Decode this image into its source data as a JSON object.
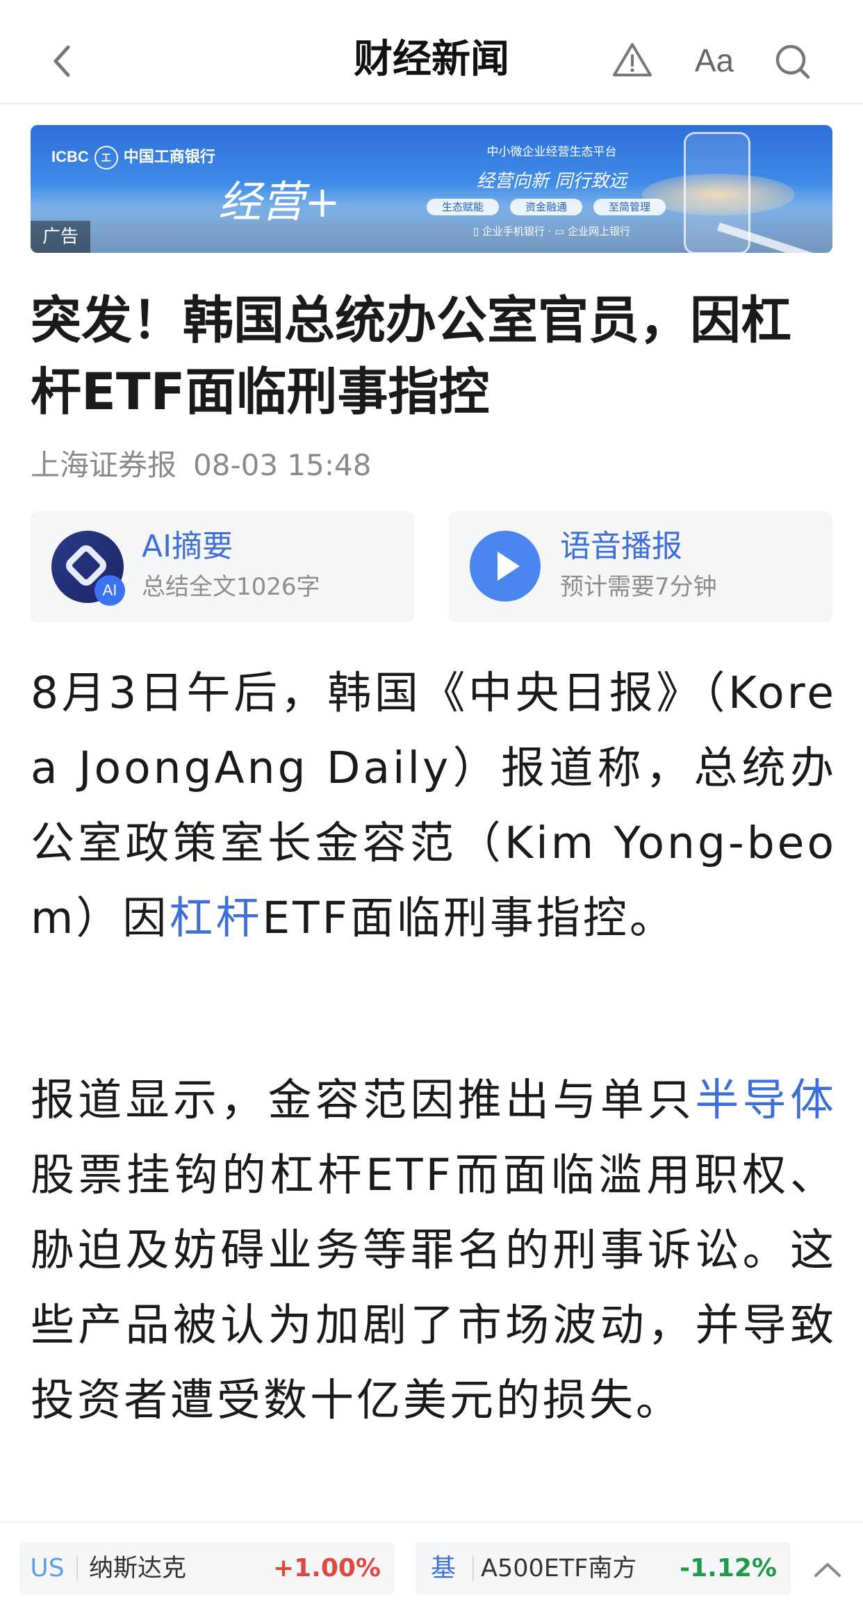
{
  "header": {
    "title": "财经新闻",
    "font_label": "Aa",
    "icons": [
      "back-icon",
      "report-icon",
      "font-size-icon",
      "search-icon"
    ]
  },
  "ad": {
    "label": "广告",
    "bank": "ICBC",
    "bank_cn": "中国工商银行",
    "bank_mark": "工",
    "slogan": "经营+",
    "platform": "中小微企业经营生态平台",
    "tagline": "经营向新 同行致远",
    "pills": [
      "生态赋能",
      "资金融通",
      "至简管理"
    ],
    "channels": "▯ 企业手机银行 · ▭ 企业网上银行"
  },
  "article": {
    "title": "突发！韩国总统办公室官员，因杠杆ETF面临刑事指控",
    "source": "上海证券报",
    "time": "08-03 15:48",
    "ai_summary": {
      "title": "AI摘要",
      "subtitle": "总结全文1026字",
      "badge": "AI"
    },
    "audio": {
      "title": "语音播报",
      "subtitle": "预计需要7分钟"
    },
    "p1": {
      "before": "8月3日午后，韩国《中央日报》（Korea JoongAng Daily）报道称，总统办公室政策室长金容范（Kim Yong-beom）因",
      "link": "杠杆",
      "after": "ETF面临刑事指控。"
    },
    "p2": {
      "before": "报道显示，金容范因推出与单只",
      "link": "半导体",
      "after": "股票挂钩的杠杆ETF而面临滥用职权、胁迫及妨碍业务等罪名的刑事诉讼。这些产品被认为加剧了市场波动，并导致投资者遭受数十亿美元的损失。"
    }
  },
  "ticker": [
    {
      "code": "US",
      "name": "纳斯达克",
      "change": "+1.00%",
      "color": "#e0473d",
      "code_color": "#5aa0e6"
    },
    {
      "code": "基",
      "name": "A500ETF南方",
      "change": "-1.12%",
      "color": "#1f9a4a",
      "code_color": "#3e6fd6"
    }
  ],
  "colors": {
    "accent": "#3e6fd6",
    "up": "#e0473d",
    "down": "#1f9a4a"
  }
}
